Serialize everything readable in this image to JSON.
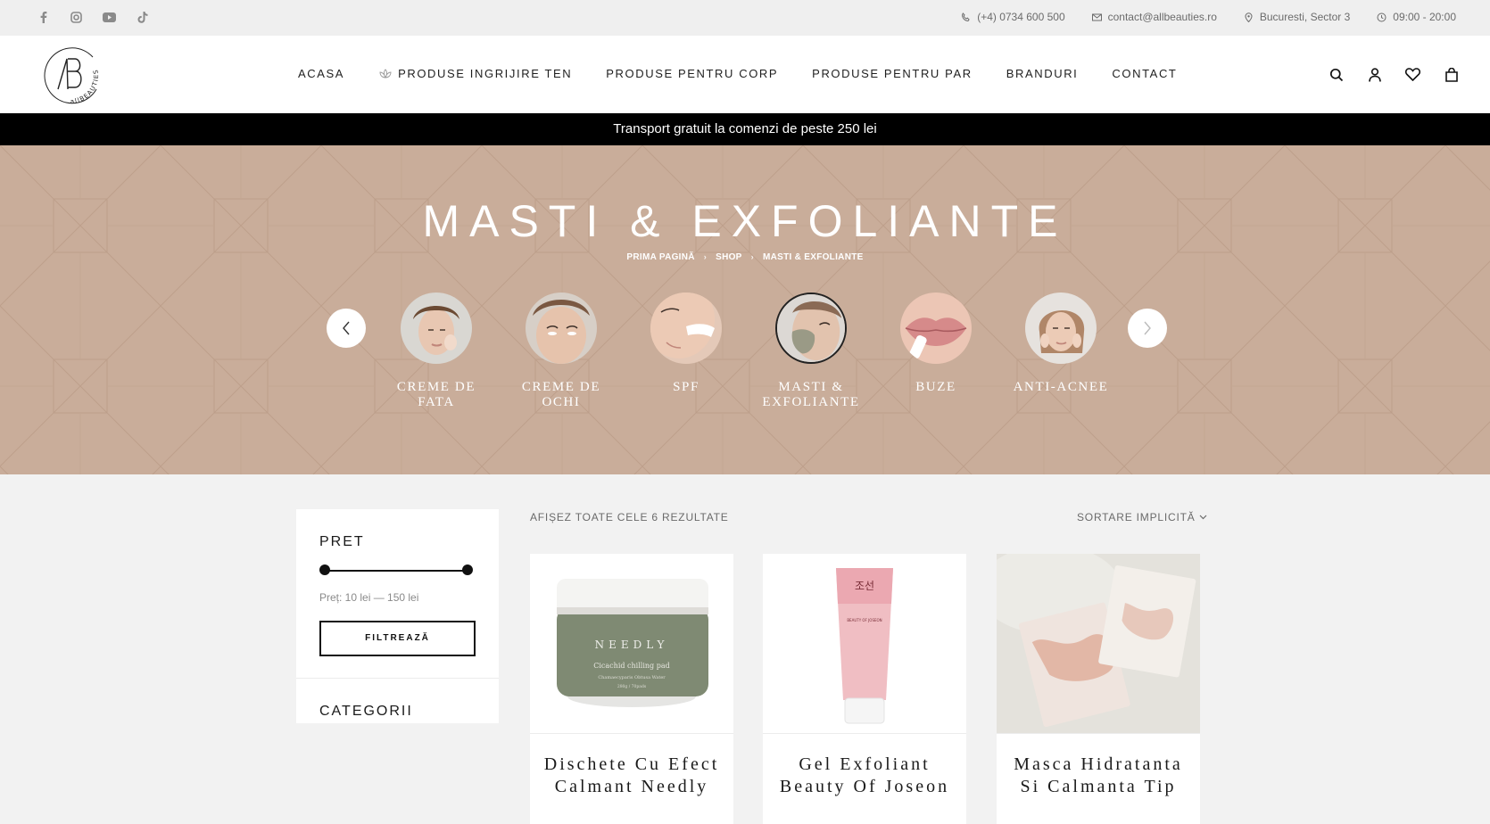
{
  "topbar": {
    "social": [
      "facebook-icon",
      "instagram-icon",
      "youtube-icon",
      "tiktok-icon"
    ],
    "phone": "(+4) 0734 600 500",
    "email": "contact@allbeauties.ro",
    "location": "Bucuresti, Sector 3",
    "hours": "09:00 - 20:00"
  },
  "header": {
    "logo": {
      "letters": "AB",
      "ring_text": "allBEAUTIES"
    },
    "nav": [
      {
        "label": "ACASA"
      },
      {
        "label": "PRODUSE INGRIJIRE TEN",
        "icon": "lotus-icon"
      },
      {
        "label": "PRODUSE PENTRU CORP"
      },
      {
        "label": "PRODUSE PENTRU PAR"
      },
      {
        "label": "BRANDURI"
      },
      {
        "label": "CONTACT"
      }
    ],
    "icons": [
      "search-icon",
      "account-icon",
      "wishlist-icon",
      "cart-icon"
    ]
  },
  "promo": {
    "text": "Transport gratuit la comenzi de peste 250 lei"
  },
  "hero": {
    "title": "MASTI & EXFOLIANTE",
    "breadcrumb": [
      "PRIMA PAGINĂ",
      "SHOP",
      "MASTI & EXFOLIANTE"
    ],
    "categories": [
      {
        "label": "CREME DE FATA",
        "active": false
      },
      {
        "label": "CREME DE OCHI",
        "active": false
      },
      {
        "label": "SPF",
        "active": false
      },
      {
        "label": "MASTI & EXFOLIANTE",
        "active": true
      },
      {
        "label": "BUZE",
        "active": false
      },
      {
        "label": "ANTI-ACNEE",
        "active": false
      }
    ],
    "colors": {
      "background": "#c9ad9a"
    }
  },
  "sidebar": {
    "price_title": "PRET",
    "price_range": "Preț: 10 lei — 150 lei",
    "filter_button": "FILTREAZĂ",
    "categories_title": "CATEGORII"
  },
  "listing": {
    "results": "AFIȘEZ TOATE CELE 6 REZULTATE",
    "sort": "SORTARE IMPLICITĂ",
    "products": [
      {
        "name": "Dischete Cu Efect Calmant Needly",
        "jar_brand": "NEEDLY",
        "jar_line1": "Cicachid chilling pad",
        "jar_line2": "Chamaecyparis Obtusa Water",
        "jar_line3": "280g / 70pads"
      },
      {
        "name": "Gel Exfoliant Beauty Of Joseon",
        "tube_brand": "BEAUTY OF JOSEON"
      },
      {
        "name": "Masca Hidratanta Si Calmanta Tip"
      }
    ]
  }
}
